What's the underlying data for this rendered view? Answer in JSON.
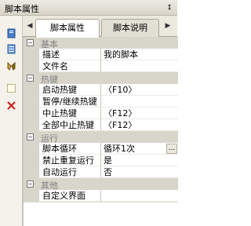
{
  "window": {
    "title": "脚本属性",
    "pin_glyph": "ɪ"
  },
  "tabs": [
    {
      "label": "脚本属性",
      "active": true
    },
    {
      "label": "脚本说明",
      "active": false
    }
  ],
  "tab_nav": {
    "left": "◀",
    "right": "▶"
  },
  "left_icons": [
    "document-icon",
    "list-icon",
    "settings-icon",
    "new-icon",
    "delete-icon"
  ],
  "grid": {
    "collapse_glyph": "−",
    "ellipsis_glyph": "...",
    "categories": [
      {
        "label": "基本",
        "rows": [
          {
            "name": "描述",
            "value": "我的脚本"
          },
          {
            "name": "文件名",
            "value": ""
          }
        ]
      },
      {
        "label": "热键",
        "rows": [
          {
            "name": "启动热键",
            "value": "〈F10〉"
          },
          {
            "name": "暂停/继续热键",
            "value": ""
          },
          {
            "name": "中止热键",
            "value": "〈F12〉"
          },
          {
            "name": "全部中止热键",
            "value": "〈F12〉"
          }
        ]
      },
      {
        "label": "运行",
        "rows": [
          {
            "name": "脚本循环",
            "value": "循环1次",
            "has_button": true
          },
          {
            "name": "禁止重复运行",
            "value": "是"
          },
          {
            "name": "自动运行",
            "value": "否"
          }
        ]
      },
      {
        "label": "其他",
        "rows": [
          {
            "name": "自定义界面",
            "value": ""
          }
        ]
      }
    ]
  }
}
